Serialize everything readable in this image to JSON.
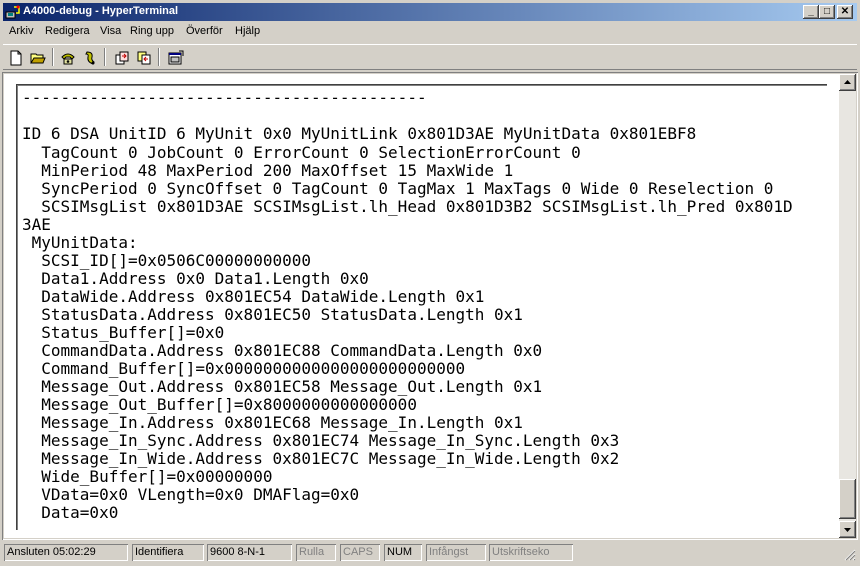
{
  "window": {
    "title": "A4000-debug - HyperTerminal",
    "controls": {
      "minimize": "_",
      "maximize": "□",
      "close": "✕"
    }
  },
  "menu": [
    "Arkiv",
    "Redigera",
    "Visa",
    "Ring upp",
    "Överför",
    "Hjälp"
  ],
  "toolbar": {
    "buttons": [
      "new-document-icon",
      "open-folder-icon",
      "call-phone-icon",
      "disconnect-icon",
      "send-file-icon",
      "receive-file-icon",
      "properties-icon"
    ]
  },
  "terminal": {
    "lines": [
      "------------------------------------------",
      "",
      "ID 6 DSA UnitID 6 MyUnit 0x0 MyUnitLink 0x801D3AE MyUnitData 0x801EBF8",
      "  TagCount 0 JobCount 0 ErrorCount 0 SelectionErrorCount 0",
      "  MinPeriod 48 MaxPeriod 200 MaxOffset 15 MaxWide 1",
      "  SyncPeriod 0 SyncOffset 0 TagCount 0 TagMax 1 MaxTags 0 Wide 0 Reselection 0",
      "  SCSIMsgList 0x801D3AE SCSIMsgList.lh_Head 0x801D3B2 SCSIMsgList.lh_Pred 0x801D",
      "3AE",
      " MyUnitData:",
      "  SCSI_ID[]=0x0506C00000000000",
      "  Data1.Address 0x0 Data1.Length 0x0",
      "  DataWide.Address 0x801EC54 DataWide.Length 0x1",
      "  StatusData.Address 0x801EC50 StatusData.Length 0x1",
      "  Status_Buffer[]=0x0",
      "  CommandData.Address 0x801EC88 CommandData.Length 0x0",
      "  Command_Buffer[]=0x0000000000000000000000000",
      "  Message_Out.Address 0x801EC58 Message_Out.Length 0x1",
      "  Message_Out_Buffer[]=0x8000000000000000",
      "  Message_In.Address 0x801EC68 Message_In.Length 0x1",
      "  Message_In_Sync.Address 0x801EC74 Message_In_Sync.Length 0x3",
      "  Message_In_Wide.Address 0x801EC7C Message_In_Wide.Length 0x2",
      "  Wide_Buffer[]=0x00000000",
      "  VData=0x0 VLength=0x0 DMAFlag=0x0",
      "  Data=0x0"
    ]
  },
  "statusbar": {
    "connected": "Ansluten 05:02:29",
    "emulation": "Identifiera",
    "settings": "9600 8-N-1",
    "scroll": "Rulla",
    "caps": "CAPS",
    "num": "NUM",
    "capture": "Infångst",
    "print_echo": "Utskriftseko"
  }
}
